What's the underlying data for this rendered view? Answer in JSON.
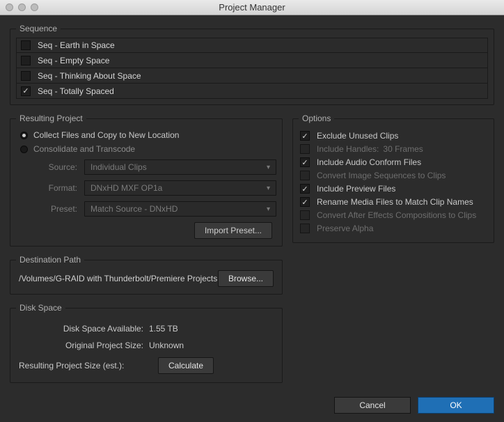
{
  "window": {
    "title": "Project Manager"
  },
  "sequence": {
    "legend": "Sequence",
    "items": [
      {
        "label": "Seq - Earth in Space",
        "checked": false
      },
      {
        "label": "Seq - Empty Space",
        "checked": false
      },
      {
        "label": "Seq - Thinking About Space",
        "checked": false
      },
      {
        "label": "Seq - Totally Spaced",
        "checked": true
      }
    ]
  },
  "resulting": {
    "legend": "Resulting Project",
    "radio1": "Collect Files and Copy to New Location",
    "radio2": "Consolidate and Transcode",
    "source_label": "Source:",
    "source_value": "Individual Clips",
    "format_label": "Format:",
    "format_value": "DNxHD MXF OP1a",
    "preset_label": "Preset:",
    "preset_value": "Match Source - DNxHD",
    "import_preset": "Import Preset..."
  },
  "options": {
    "legend": "Options",
    "exclude": "Exclude Unused Clips",
    "handles_label": "Include Handles:",
    "handles_value": "30 Frames",
    "audio": "Include Audio Conform Files",
    "convert_seq": "Convert Image Sequences to Clips",
    "preview": "Include Preview Files",
    "rename": "Rename Media Files to Match Clip Names",
    "ae": "Convert After Effects Compositions to Clips",
    "alpha": "Preserve Alpha"
  },
  "destination": {
    "legend": "Destination Path",
    "path": "/Volumes/G-RAID with Thunderbolt/Premiere Projects",
    "browse": "Browse..."
  },
  "disk": {
    "legend": "Disk Space",
    "available_label": "Disk Space Available:",
    "available_value": "1.55 TB",
    "original_label": "Original Project Size:",
    "original_value": "Unknown",
    "resulting_label": "Resulting Project Size (est.):",
    "calculate": "Calculate"
  },
  "footer": {
    "cancel": "Cancel",
    "ok": "OK"
  }
}
